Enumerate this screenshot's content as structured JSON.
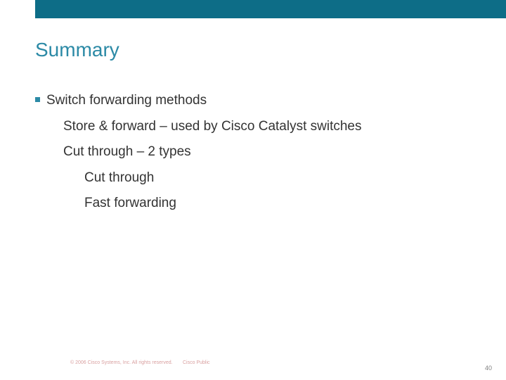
{
  "title": "Summary",
  "bullets": {
    "item1": "Switch forwarding methods",
    "item1a": "Store & forward – used by Cisco Catalyst switches",
    "item1b": "Cut through – 2 types",
    "item1b1": "Cut through",
    "item1b2": "Fast forwarding"
  },
  "footer": {
    "copyright": "© 2006 Cisco Systems, Inc. All rights reserved.",
    "public": "Cisco Public",
    "page": "40"
  }
}
